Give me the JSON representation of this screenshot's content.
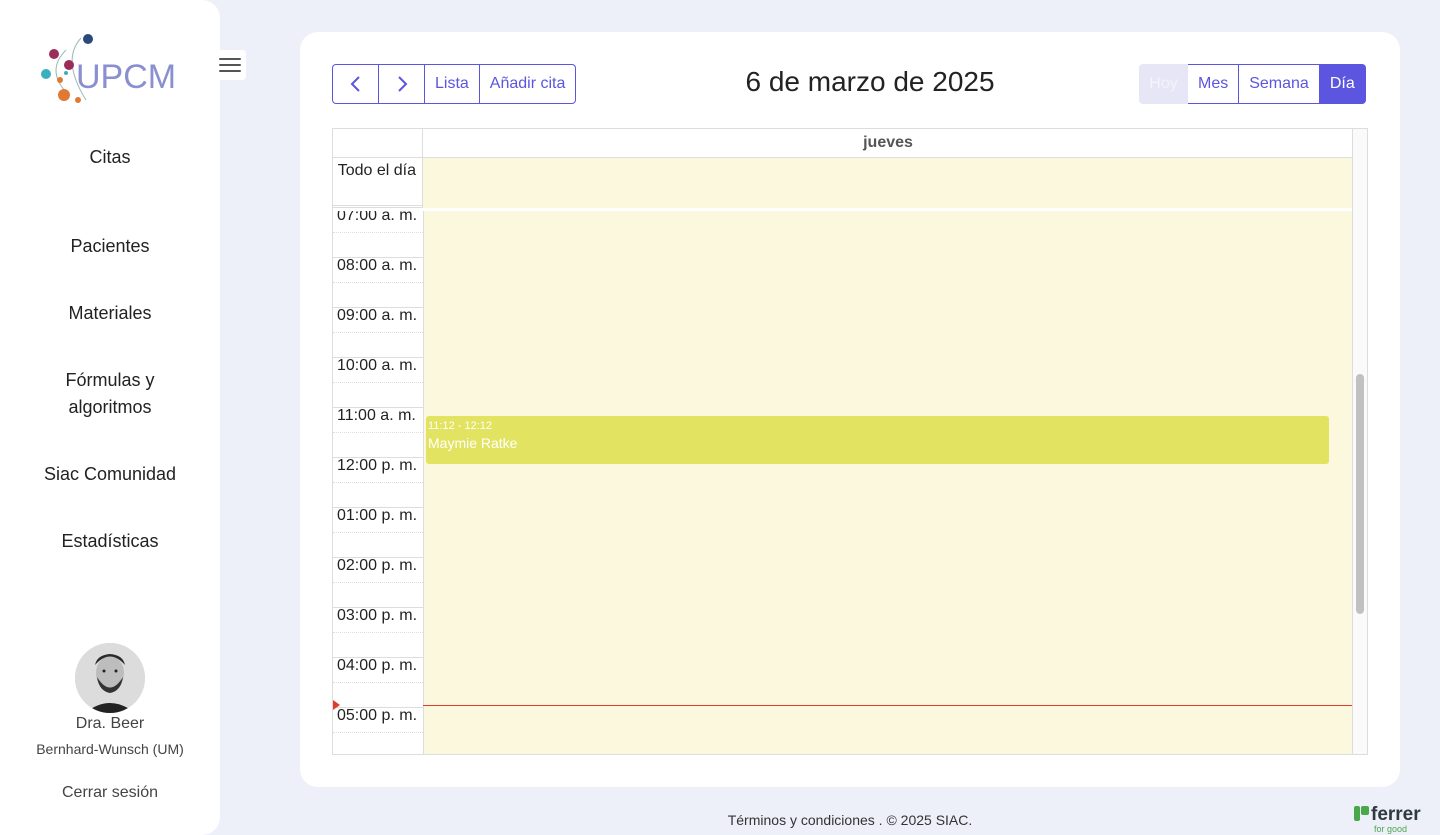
{
  "sidebar": {
    "logo_text": "UPCM",
    "items": [
      {
        "label": "Citas"
      },
      {
        "label": "Pacientes"
      },
      {
        "label": "Materiales"
      },
      {
        "label": "Fórmulas y algoritmos"
      },
      {
        "label": "Siac Comunidad"
      },
      {
        "label": "Estadísticas"
      }
    ],
    "user": {
      "name": "Dra. Beer",
      "org": "Bernhard-Wunsch (UM)"
    },
    "logout_label": "Cerrar sesión"
  },
  "toolbar": {
    "prev_icon": "chevron-left-icon",
    "next_icon": "chevron-right-icon",
    "list_label": "Lista",
    "add_label": "Añadir cita",
    "title": "6 de marzo de 2025",
    "views": [
      {
        "label": "Hoy",
        "state": "disabled"
      },
      {
        "label": "Mes",
        "state": "normal"
      },
      {
        "label": "Semana",
        "state": "normal"
      },
      {
        "label": "Día",
        "state": "active"
      }
    ]
  },
  "calendar": {
    "day_header": "jueves",
    "allday_label": "Todo el día",
    "times": [
      "07:00 a. m.",
      "08:00 a. m.",
      "09:00 a. m.",
      "10:00 a. m.",
      "11:00 a. m.",
      "12:00 p. m.",
      "01:00 p. m.",
      "02:00 p. m.",
      "03:00 p. m.",
      "04:00 p. m.",
      "05:00 p. m."
    ],
    "event": {
      "time": "11:12 - 12:12",
      "title": "Maymie Ratke"
    }
  },
  "footer": {
    "text": "Términos y condiciones . © 2025 SIAC."
  },
  "brand": {
    "name": "ferrer",
    "tagline": "for good"
  },
  "colors": {
    "accent": "#5b55e0",
    "event": "#e2e360",
    "now_line": "#e13c2e",
    "grid_bg": "#fcf8dd"
  }
}
